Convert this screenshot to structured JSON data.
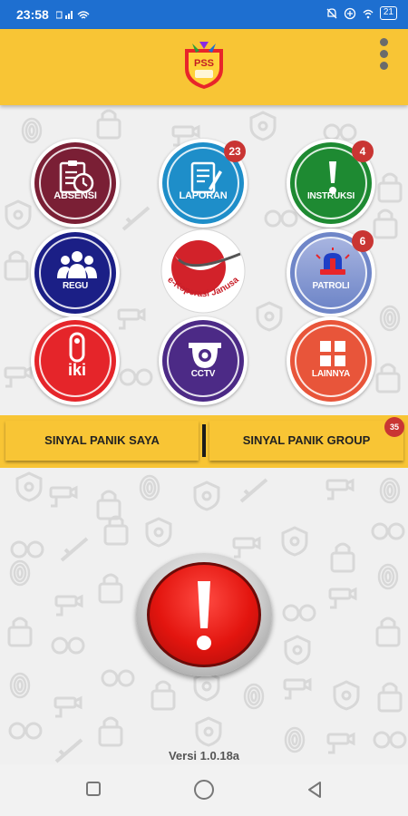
{
  "status_bar": {
    "time": "23:58",
    "battery": "21"
  },
  "menu": [
    {
      "id": "absensi",
      "label": "ABSENSI",
      "badge": "",
      "color": "#7a1f35",
      "icon": "clipboard-clock-icon"
    },
    {
      "id": "laporan",
      "label": "LAPORAN",
      "badge": "23",
      "color": "#1e8ec9",
      "icon": "report-pen-icon"
    },
    {
      "id": "instruksi",
      "label": "INSTRUKSI",
      "badge": "4",
      "color": "#1e8a32",
      "icon": "exclamation-icon"
    },
    {
      "id": "regu",
      "label": "REGU",
      "badge": "",
      "color": "#1b1f86",
      "icon": "group-people-icon"
    },
    {
      "id": "koperasi",
      "label": "e-Koperasi Janusa",
      "badge": "",
      "color": "#d2222a",
      "icon": "janusa-logo"
    },
    {
      "id": "patroli",
      "label": "PATROLI",
      "badge": "6",
      "color": "#6f86c8",
      "icon": "siren-icon"
    },
    {
      "id": "iki",
      "label": "iki",
      "badge": "",
      "color": "#e5252a",
      "icon": "iki-icon"
    },
    {
      "id": "cctv",
      "label": "CCTV",
      "badge": "",
      "color": "#4c2a86",
      "icon": "camera-icon"
    },
    {
      "id": "lainnya",
      "label": "LAINNYA",
      "badge": "",
      "color": "#e8553a",
      "icon": "grid-icon"
    }
  ],
  "panic_tabs": {
    "my_label": "SINYAL PANIK SAYA",
    "group_label": "SINYAL PANIK GROUP",
    "group_badge": "35"
  },
  "version": "Versi 1.0.18a",
  "logo_text": "PSS",
  "colors": {
    "status_bar": "#1e6fd0",
    "app_bar": "#f8c535",
    "badge": "#c93533",
    "panic_red": "#e3150f"
  }
}
